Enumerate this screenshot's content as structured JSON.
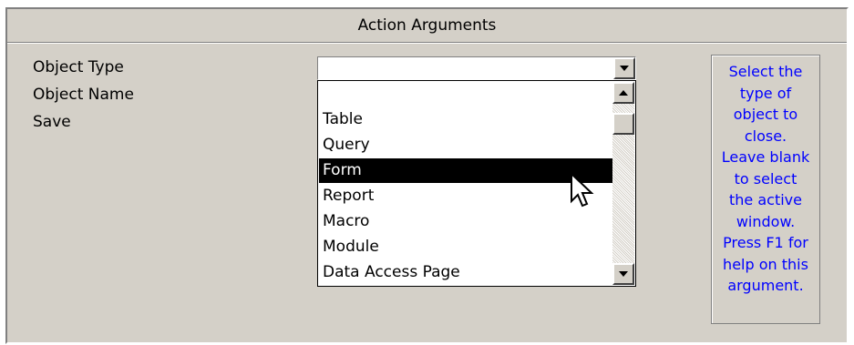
{
  "header": {
    "title": "Action Arguments"
  },
  "arguments": [
    {
      "label": "Object Type"
    },
    {
      "label": "Object Name"
    },
    {
      "label": "Save"
    }
  ],
  "object_type_field": {
    "value": ""
  },
  "dropdown": {
    "items": [
      "",
      "Table",
      "Query",
      "Form",
      "Report",
      "Macro",
      "Module",
      "Data Access Page"
    ],
    "selected": "Form"
  },
  "help": {
    "lines": [
      "Select the",
      "type of",
      "object to",
      "close.",
      "Leave blank",
      "to select",
      "the active",
      "window.",
      "Press F1 for",
      "help on this",
      "argument."
    ]
  },
  "colors": {
    "panel": "#d4d0c8",
    "selection_bg": "#000000",
    "selection_fg": "#ffffff",
    "help_text": "#0000ff"
  },
  "icons": [
    "dropdown-arrow-icon",
    "scroll-up-arrow-icon",
    "scroll-down-arrow-icon",
    "mouse-pointer-icon"
  ]
}
